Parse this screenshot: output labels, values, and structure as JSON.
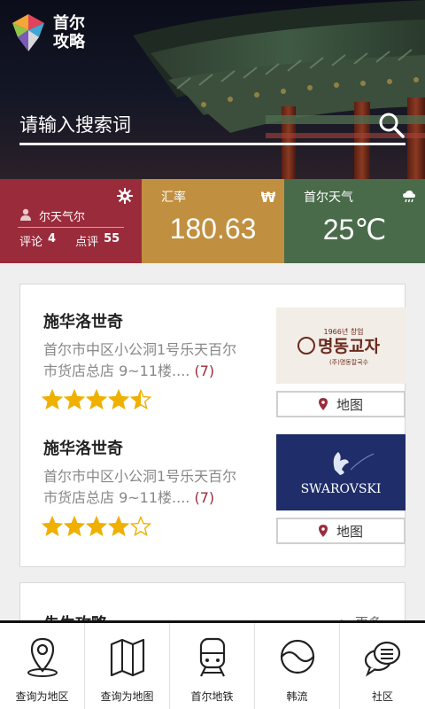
{
  "header": {
    "app_title_line1": "首尔",
    "app_title_line2": "攻略",
    "search_placeholder": "请输入搜索词"
  },
  "tiles": {
    "user": {
      "name": "尔天气尔",
      "comments_label": "评论",
      "comments_count": "4",
      "reviews_label": "点评",
      "reviews_count": "55",
      "color": "#9a2b3b"
    },
    "rate": {
      "title": "汇率",
      "value": "180.63",
      "currency_icon": "₩",
      "color": "#c08f3f"
    },
    "weather": {
      "title": "首尔天气",
      "value": "25℃",
      "icon": "cloud-rain-icon",
      "color": "#496b4a"
    }
  },
  "listings": [
    {
      "name": "施华洛世奇",
      "address": "首尔市中区小公洞1号乐天百尔市货店总店 9~11楼....",
      "review_count": "(7)",
      "rating": 4.5,
      "image": "myeongdong-gyoja-logo",
      "map_label": "地图"
    },
    {
      "name": "施华洛世奇",
      "address": "首尔市中区小公洞1号乐天百尔市货店总店 9~11楼....",
      "review_count": "(7)",
      "rating": 4,
      "image": "swarovski-logo",
      "map_label": "地图"
    }
  ],
  "thumb_text": {
    "gyoja_year": "1966년 창업",
    "gyoja_name": "명동교자",
    "gyoja_sub": "(주)명동칼국수",
    "swarovski": "SWAROVSKI"
  },
  "section": {
    "title": "先生攻略",
    "more": "> 更多"
  },
  "nav": [
    {
      "label": "查询为地区",
      "icon": "location-pin-icon"
    },
    {
      "label": "查询为地图",
      "icon": "folded-map-icon"
    },
    {
      "label": "首尔地铁",
      "icon": "subway-train-icon"
    },
    {
      "label": "韩流",
      "icon": "taegeuk-icon"
    },
    {
      "label": "社区",
      "icon": "chat-bubbles-icon"
    }
  ]
}
